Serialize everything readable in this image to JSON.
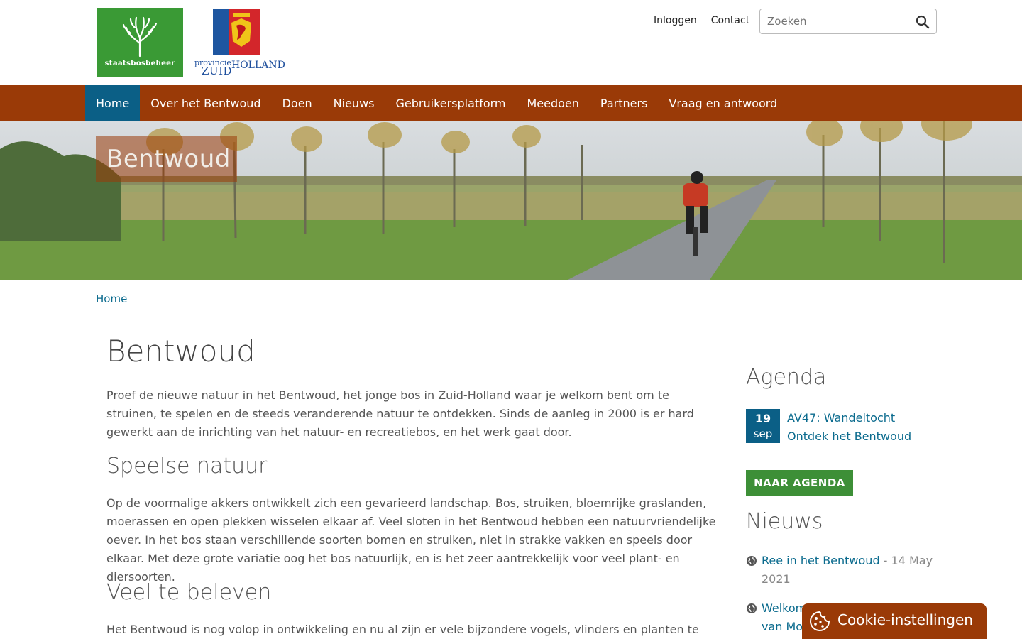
{
  "header": {
    "logo_staatsbosbeheer": "staatsbosbeheer",
    "logo_provincie_small": "provincie",
    "logo_provincie_zuid": "ZUID",
    "logo_provincie_holland": "HOLLAND",
    "top_links": [
      "Inloggen",
      "Contact"
    ],
    "search_placeholder": "Zoeken"
  },
  "nav": {
    "items": [
      "Home",
      "Over het Bentwoud",
      "Doen",
      "Nieuws",
      "Gebruikersplatform",
      "Meedoen",
      "Partners",
      "Vraag en antwoord"
    ],
    "active": "Home"
  },
  "hero": {
    "title": "Bentwoud"
  },
  "breadcrumb": {
    "home": "Home"
  },
  "main": {
    "title": "Bentwoud",
    "intro": "Proef de nieuwe natuur in het Bentwoud, het jonge bos in Zuid-Holland waar je welkom bent om te struinen, te spelen en de steeds veranderende natuur te ontdekken. Sinds de aanleg in 2000 is er hard gewerkt aan de inrichting van het natuur- en recreatiebos, en het werk gaat door.",
    "section1_title": "Speelse natuur",
    "section1_text": "Op de voormalige akkers ontwikkelt zich een gevarieerd landschap. Bos, struiken, bloemrijke graslanden, moerassen en open plekken wisselen elkaar af. Veel sloten in het Bentwoud hebben een natuurvriendelijke oever. In het bos staan verschillende soorten bomen en struiken, niet in strakke vakken en speels door elkaar. Met deze grote variatie oog het bos natuurlijk, en is het zeer aantrekkelijk voor veel plant- en diersoorten.",
    "section2_title": "Veel te beleven",
    "section2_text": "Het Bentwoud is nog volop in ontwikkeling en nu al zijn er vele bijzondere vogels, vlinders en planten te vinden."
  },
  "sidebar": {
    "agenda_title": "Agenda",
    "event": {
      "day": "19",
      "month": "sep",
      "title": "AV47: Wandeltocht Ontdek het Bentwoud"
    },
    "agenda_button": "NAAR AGENDA",
    "news_title": "Nieuws",
    "news": [
      {
        "title": "Ree in het Bentwoud",
        "date": " - 14 May 2021"
      },
      {
        "title": "Welkom in het Bentwoud, ook van Mooi",
        "date": ""
      }
    ]
  },
  "cookie": {
    "label": "Cookie-instellingen"
  },
  "colors": {
    "nav_bg": "#9a3a07",
    "nav_active": "#0b5f86",
    "link": "#0b6b8e",
    "button_green": "#3d8f37",
    "logo_green": "#3a9a35"
  }
}
